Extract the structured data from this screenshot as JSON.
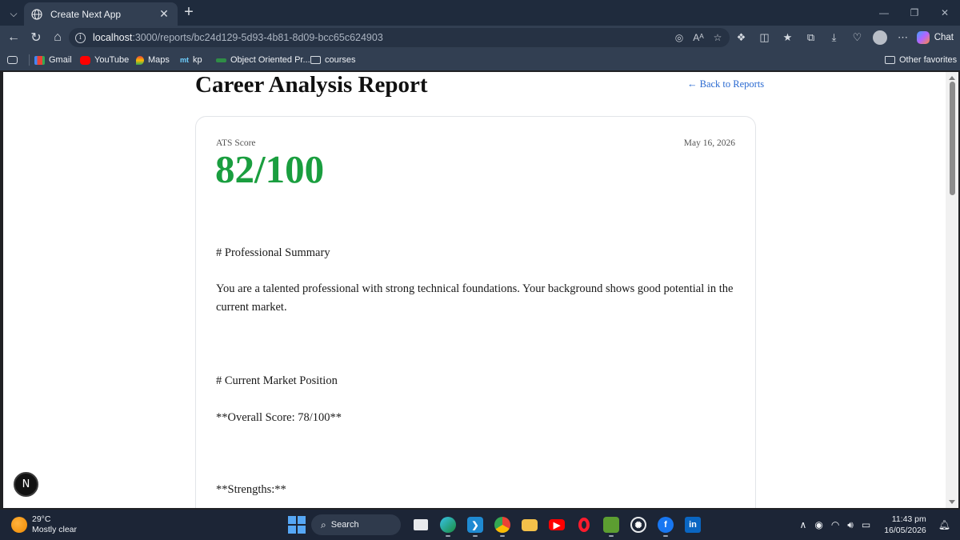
{
  "browser": {
    "tab_title": "Create Next App",
    "url_host": "localhost",
    "url_path": ":3000/reports/bc24d129-5d93-4b81-8d09-bcc65c624903",
    "chat_label": "Chat"
  },
  "bookmarks": [
    "Gmail",
    "YouTube",
    "Maps",
    "kp",
    "Object Oriented Pr...",
    "courses"
  ],
  "bookmark_favicons": [
    "M",
    "",
    "",
    "mt",
    "",
    ""
  ],
  "other_favorites": "Other favorites",
  "page": {
    "title": "Career Analysis Report",
    "back_link": "← Back to Reports",
    "ats_label": "ATS Score",
    "date": "May 16, 2026",
    "ats_score": "82/100",
    "score_color": "#1a9e3f",
    "sections": [
      "# Professional Summary",
      "You are a talented professional with strong technical foundations. Your background shows good potential in the current market.",
      "# Current Market Position",
      "**Overall Score: 78/100**",
      "**Strengths:**"
    ]
  },
  "next_badge": "N",
  "taskbar": {
    "temperature": "29°C",
    "condition": "Mostly clear",
    "search_label": "Search",
    "time": "11:43 pm",
    "date": "16/05/2026"
  }
}
